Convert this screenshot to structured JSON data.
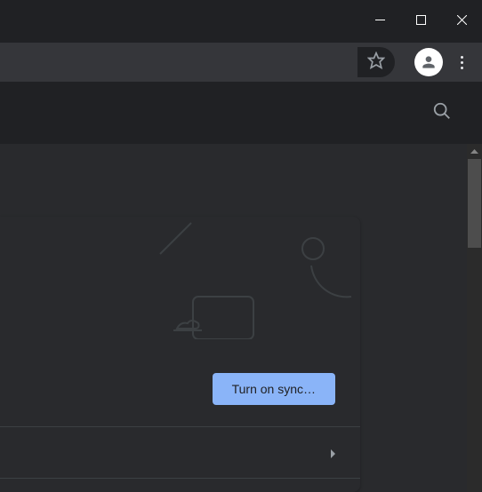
{
  "sync": {
    "button_label": "Turn on sync…"
  }
}
